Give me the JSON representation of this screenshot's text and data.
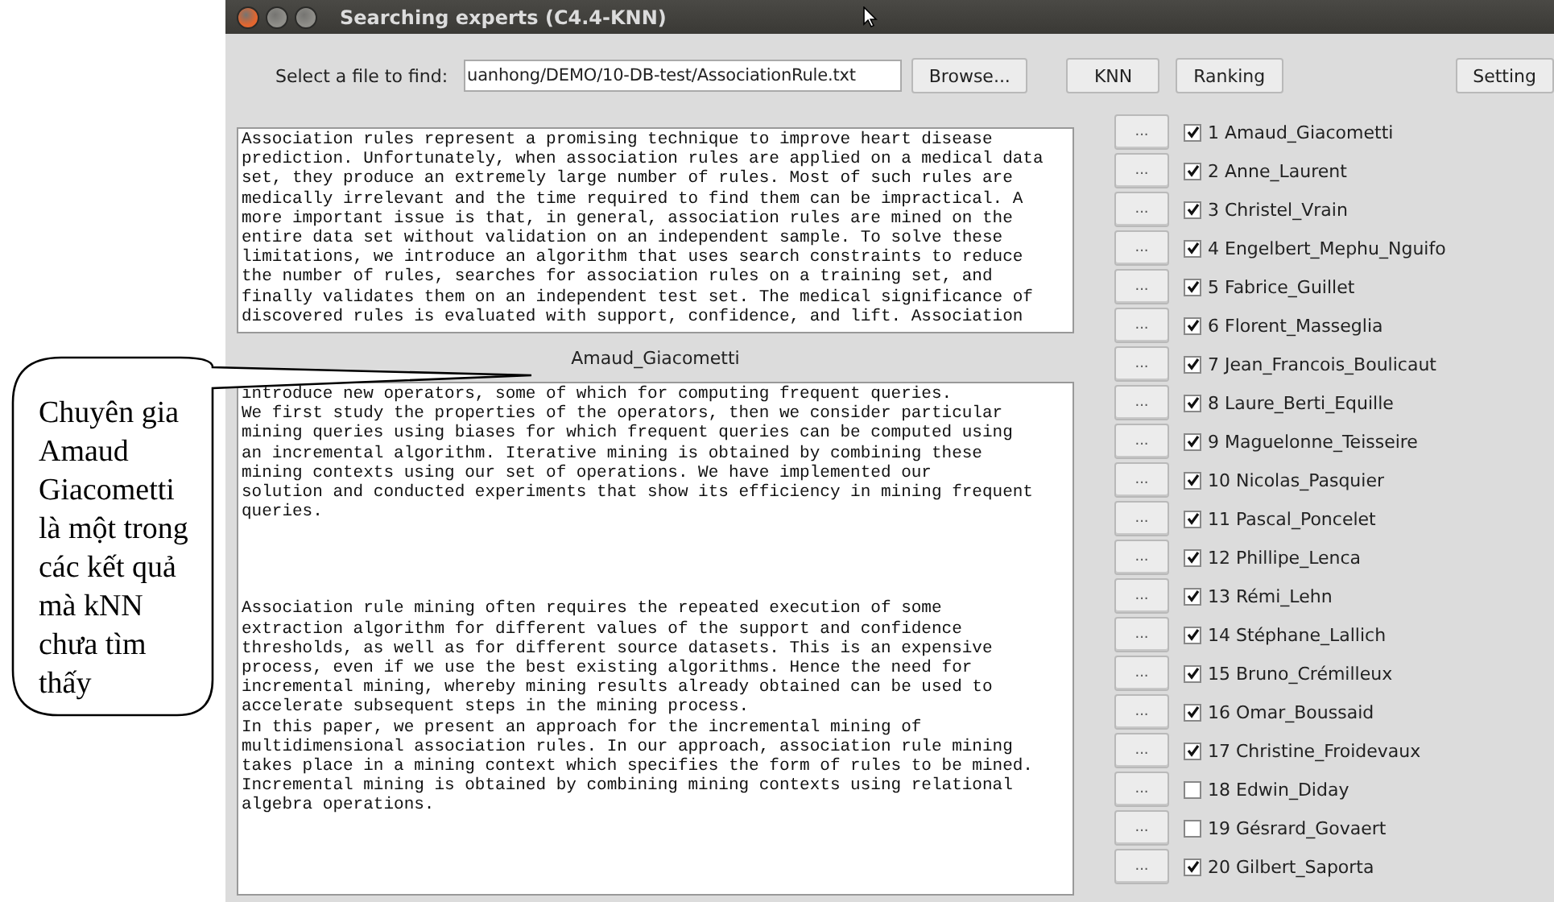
{
  "window": {
    "title": "Searching experts (C4.4-KNN)"
  },
  "toolbar": {
    "file_label": "Select a file to find:",
    "file_value": "uanhong/DEMO/10-DB-test/AssociationRule.txt",
    "buttons": [
      "Browse...",
      "KNN",
      "Ranking",
      "Setting"
    ]
  },
  "query_text": {
    "lines": [
      "Association rules represent a promising technique to improve heart disease",
      "prediction. Unfortunately, when association rules are applied on a medical data",
      "set, they produce an extremely large number of rules. Most of such rules are",
      "medically irrelevant and the time required to find them can be impractical. A",
      "more important issue is that, in general, association rules are mined on the",
      "entire data set without validation on an independent sample. To solve these",
      "limitations, we introduce an algorithm that uses search constraints to reduce",
      "the number of rules, searches for association rules on a training set, and",
      "finally validates them on an independent test set. The medical significance of",
      "discovered rules is evaluated with support, confidence, and lift. Association"
    ]
  },
  "expert_view": {
    "name": "Amaud_Giacometti",
    "paragraphs": [
      {
        "lines": [
          "introduce new operators, some of which for computing frequent queries.",
          "We first study the properties of the operators, then we consider particular",
          "mining queries using biases for which frequent queries can be computed using",
          "an incremental algorithm. Iterative mining is obtained by combining these",
          "mining contexts using our set of operations. We have implemented our",
          "solution and conducted experiments that show its efficiency in mining frequent",
          "queries."
        ]
      },
      {
        "lines": [
          "Association rule mining often requires the repeated execution of some",
          "extraction algorithm for different values of the support and confidence",
          "thresholds, as well as for different source datasets. This is an expensive",
          "process, even if we use the best existing algorithms. Hence the need for",
          "incremental mining, whereby mining results already obtained can be used to",
          "accelerate subsequent steps in the mining process.",
          "In this paper, we present an approach for the incremental mining of",
          "multidimensional association rules. In our approach, association rule mining",
          "takes place in a mining context which specifies the form of rules to be mined.",
          "Incremental mining is obtained by combining mining contexts using relational",
          "algebra operations."
        ]
      }
    ]
  },
  "experts": [
    {
      "button": "...",
      "label": "1 Amaud_Giacometti",
      "checked": true
    },
    {
      "button": "...",
      "label": "2 Anne_Laurent",
      "checked": true
    },
    {
      "button": "...",
      "label": "3 Christel_Vrain",
      "checked": true
    },
    {
      "button": "...",
      "label": "4 Engelbert_Mephu_Nguifo",
      "checked": true
    },
    {
      "button": "...",
      "label": "5 Fabrice_Guillet",
      "checked": true
    },
    {
      "button": "...",
      "label": "6 Florent_Masseglia",
      "checked": true
    },
    {
      "button": "...",
      "label": "7 Jean_Francois_Boulicaut",
      "checked": true
    },
    {
      "button": "...",
      "label": "8 Laure_Berti_Equille",
      "checked": true
    },
    {
      "button": "...",
      "label": "9 Maguelonne_Teisseire",
      "checked": true
    },
    {
      "button": "...",
      "label": "10 Nicolas_Pasquier",
      "checked": true
    },
    {
      "button": "...",
      "label": "11 Pascal_Poncelet",
      "checked": true
    },
    {
      "button": "...",
      "label": "12 Phillipe_Lenca",
      "checked": true
    },
    {
      "button": "...",
      "label": "13 Rémi_Lehn",
      "checked": true
    },
    {
      "button": "...",
      "label": "14 Stéphane_Lallich",
      "checked": true
    },
    {
      "button": "...",
      "label": "15 Bruno_Crémilleux",
      "checked": true
    },
    {
      "button": "...",
      "label": "16 Omar_Boussaid",
      "checked": true
    },
    {
      "button": "...",
      "label": "17 Christine_Froidevaux",
      "checked": true
    },
    {
      "button": "...",
      "label": "18 Edwin_Diday",
      "checked": false
    },
    {
      "button": "...",
      "label": "19 Gésrard_Govaert",
      "checked": false
    },
    {
      "button": "...",
      "label": "20 Gilbert_Saporta",
      "checked": true
    }
  ],
  "callout": {
    "text": "Chuyên gia Amaud Giacometti là một trong các kết quả mà kNN chưa tìm thấy"
  }
}
